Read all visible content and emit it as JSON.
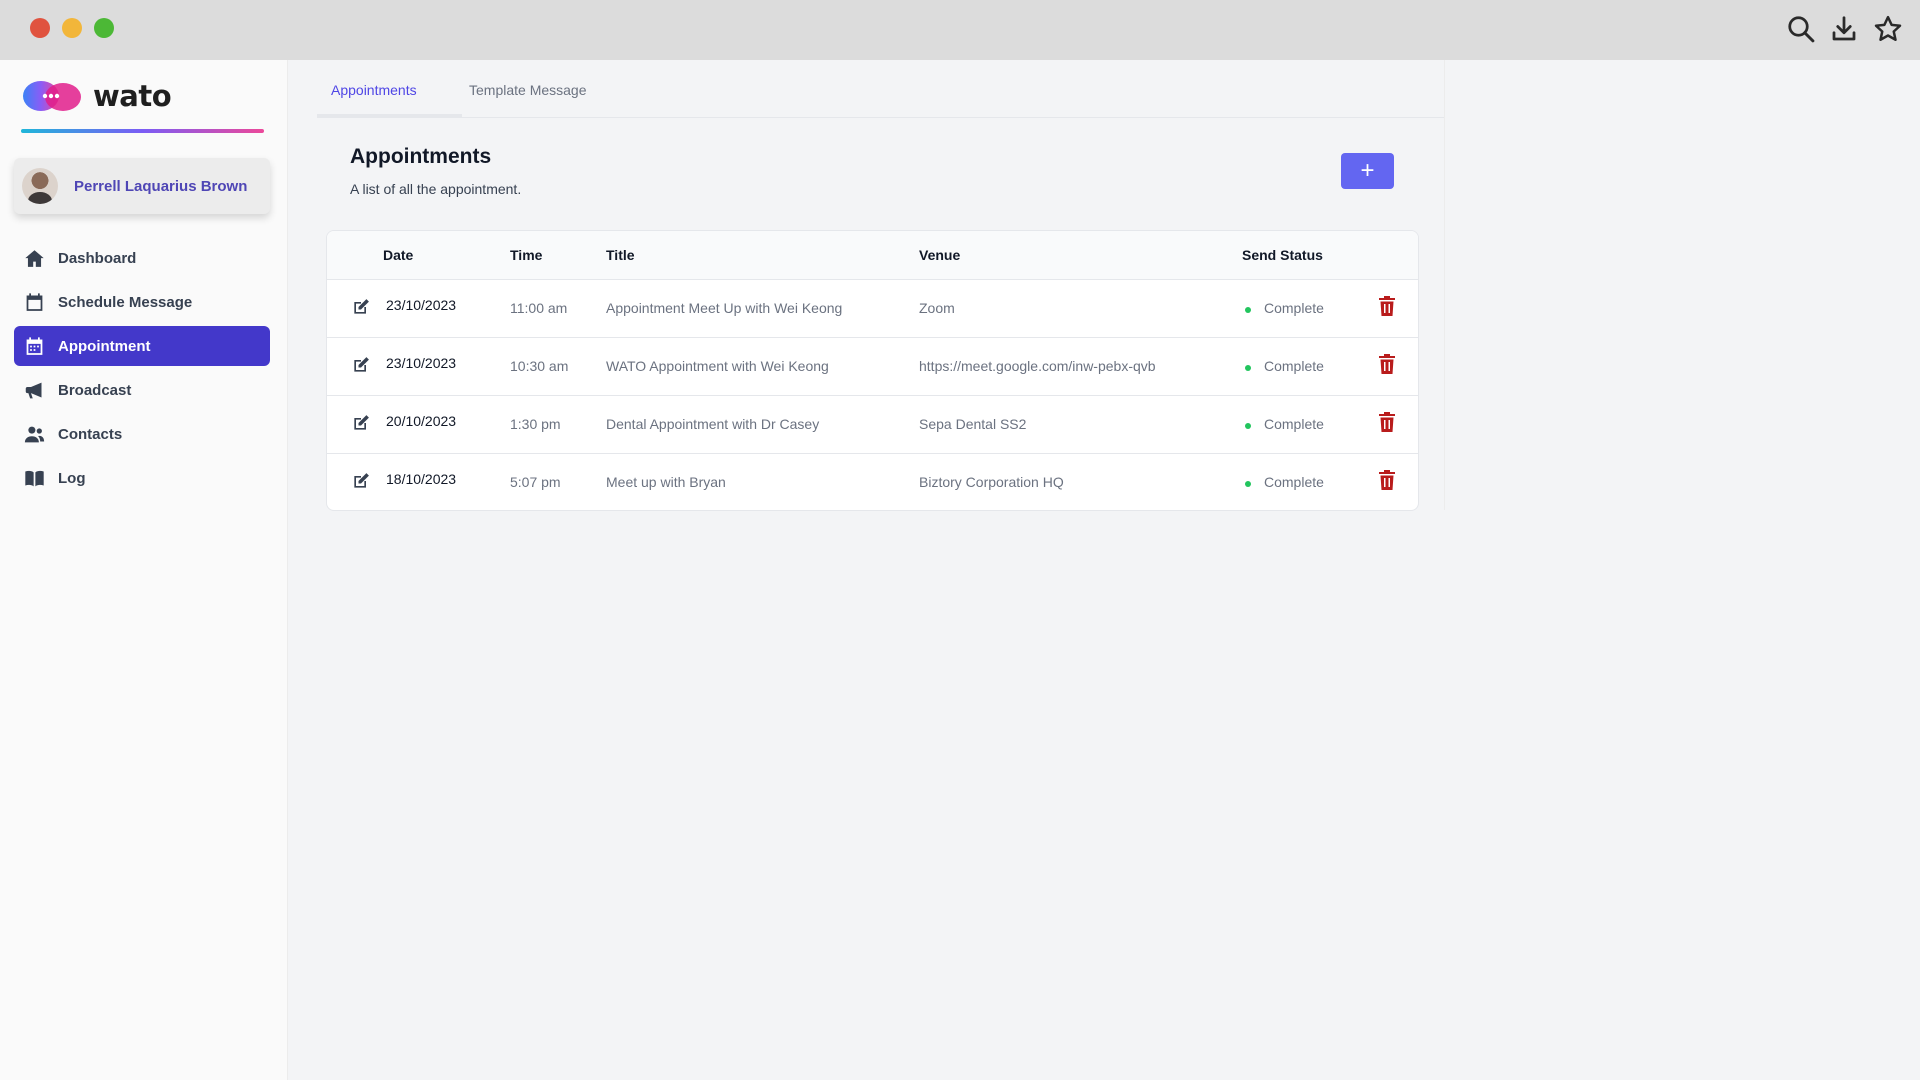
{
  "browser": {
    "icons": [
      "search-icon",
      "download-icon",
      "star-icon"
    ]
  },
  "brand": {
    "name": "wato",
    "accent": "#4338ca",
    "button_color": "#6366f1"
  },
  "user": {
    "name": "Perrell Laquarius Brown"
  },
  "sidebar": {
    "items": [
      {
        "label": "Dashboard",
        "icon": "home-icon",
        "active": false
      },
      {
        "label": "Schedule Message",
        "icon": "calendar-icon",
        "active": false
      },
      {
        "label": "Appointment",
        "icon": "calendar-grid-icon",
        "active": true
      },
      {
        "label": "Broadcast",
        "icon": "megaphone-icon",
        "active": false
      },
      {
        "label": "Contacts",
        "icon": "users-icon",
        "active": false
      },
      {
        "label": "Log",
        "icon": "book-icon",
        "active": false
      }
    ]
  },
  "tabs": [
    {
      "label": "Appointments",
      "active": true
    },
    {
      "label": "Template Message",
      "active": false
    }
  ],
  "page": {
    "title": "Appointments",
    "subtitle": "A list of all the appointment.",
    "add_button": "+"
  },
  "table": {
    "columns": [
      "Date",
      "Time",
      "Title",
      "Venue",
      "Send Status"
    ],
    "rows": [
      {
        "date": "23/10/2023",
        "time": "11:00 am",
        "title": "Appointment Meet Up with Wei Keong",
        "venue": "Zoom",
        "status": "Complete"
      },
      {
        "date": "23/10/2023",
        "time": "10:30 am",
        "title": "WATO Appointment with Wei Keong",
        "venue": "https://meet.google.com/inw-pebx-qvb",
        "status": "Complete"
      },
      {
        "date": "20/10/2023",
        "time": "1:30 pm",
        "title": "Dental Appointment with Dr Casey",
        "venue": "Sepa Dental SS2",
        "status": "Complete"
      },
      {
        "date": "18/10/2023",
        "time": "5:07 pm",
        "title": "Meet up with Bryan",
        "venue": "Biztory Corporation HQ",
        "status": "Complete"
      }
    ],
    "status_color": "#22c55e",
    "delete_color": "#b91c1c"
  }
}
